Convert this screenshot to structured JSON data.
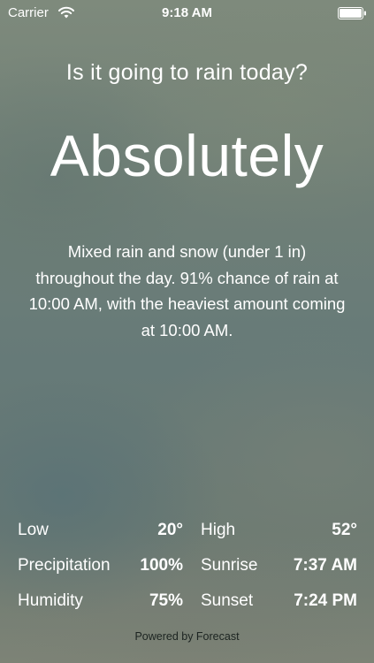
{
  "status_bar": {
    "carrier": "Carrier",
    "time": "9:18 AM",
    "wifi_icon": "wifi-icon",
    "battery_icon": "battery-full-icon"
  },
  "question": "Is it going to rain today?",
  "answer": "Absolutely",
  "summary": "Mixed rain and snow (under 1 in) throughout the day. 91% chance of rain at 10:00 AM, with the heaviest amount coming at 10:00 AM.",
  "stats": [
    {
      "label": "Low",
      "value": "20°",
      "label2": "High",
      "value2": "52°"
    },
    {
      "label": "Precipitation",
      "value": "100%",
      "label2": "Sunrise",
      "value2": "7:37 AM"
    },
    {
      "label": "Humidity",
      "value": "75%",
      "label2": "Sunset",
      "value2": "7:24 PM"
    }
  ],
  "footer": "Powered by Forecast",
  "colors": {
    "text": "#ffffff",
    "footer_text": "#1c2421",
    "background_top": "#7e8a7c",
    "background_mid": "#667a78"
  }
}
